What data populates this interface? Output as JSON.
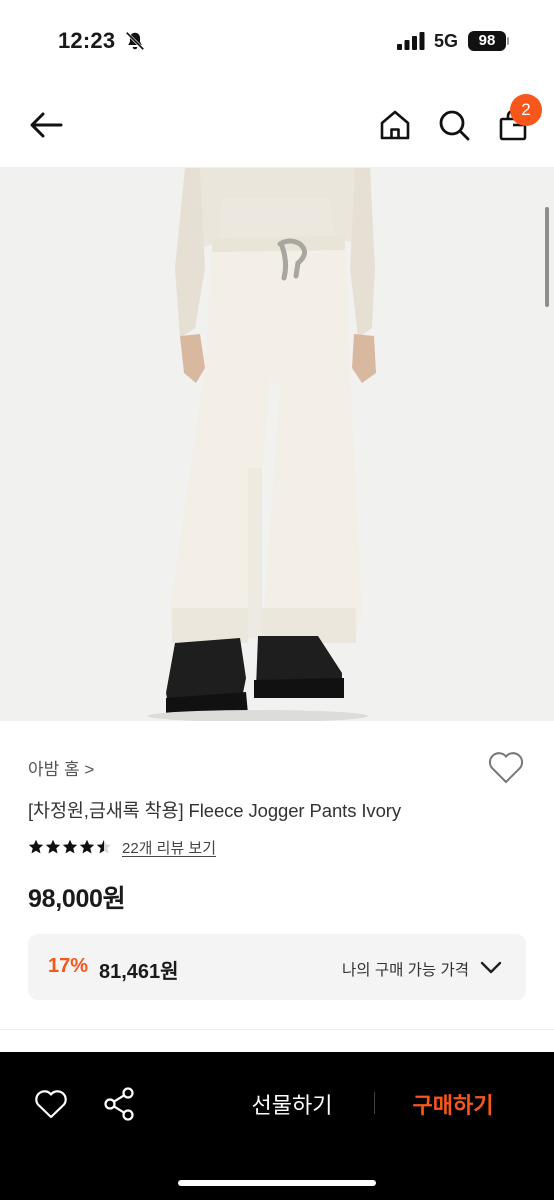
{
  "status_bar": {
    "time": "12:23",
    "network": "5G",
    "battery": "98"
  },
  "header": {
    "cart_count": "2",
    "icons": [
      "back-arrow-icon",
      "home-icon",
      "search-icon",
      "shopping-bag-icon"
    ]
  },
  "product": {
    "brand": "아밤 홈 >",
    "title": "[차정원,금새록 착용] Fleece Jogger Pants Ivory",
    "rating": 4.5,
    "review_link": "22개 리뷰 보기",
    "price": "98,000원",
    "discount_rate": "17%",
    "discount_price": "81,461원",
    "my_price_label": "나의 구매 가능 가격"
  },
  "bottom_bar": {
    "gift_label": "선물하기",
    "buy_label": "구매하기"
  },
  "colors": {
    "accent": "#f7571b",
    "bar_background": "#000000",
    "benefit_background": "#f4f4f5"
  }
}
